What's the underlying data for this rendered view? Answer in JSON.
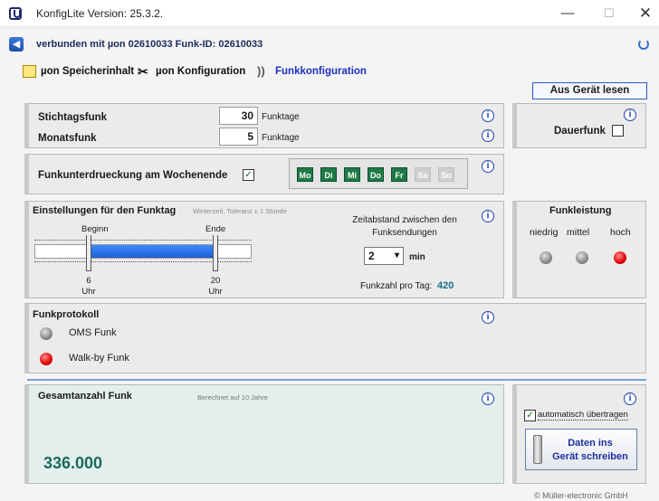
{
  "window": {
    "title": "KonfigLite  Version: 25.3.2."
  },
  "status": {
    "connection": "verbunden mit µon 02610033 Funk-ID: 02610033"
  },
  "tabs": [
    {
      "label": "µon Speicherinhalt"
    },
    {
      "label": "µon Konfiguration"
    },
    {
      "label": "Funkkonfiguration"
    }
  ],
  "read_button": "Aus Gerät lesen",
  "stichtag": {
    "label": "Stichtagsfunk",
    "value": "30",
    "unit": "Funktage"
  },
  "monat": {
    "label": "Monatsfunk",
    "value": "5",
    "unit": "Funktage"
  },
  "dauerfunk": {
    "label": "Dauerfunk"
  },
  "weekend": {
    "label": "Funkunterdrueckung am Wochenende",
    "checked_glyph": "✓",
    "days": [
      "Mo",
      "Di",
      "Mi",
      "Do",
      "Fr",
      "Sa",
      "So"
    ]
  },
  "funktag": {
    "title": "Einstellungen für den Funktag",
    "note": "Winterzeit, Toleranz ± 1 Stunde",
    "begin_label": "Beginn",
    "end_label": "Ende",
    "begin_value": "6",
    "end_value": "20",
    "unit": "Uhr",
    "range_start": 6,
    "range_end": 20,
    "interval_title": "Zeitabstand zwischen den Funksendungen",
    "interval_value": "2",
    "interval_unit": "min",
    "count_label": "Funkzahl pro Tag:",
    "count_value": "420"
  },
  "funkleistung": {
    "title": "Funkleistung",
    "levels": [
      "niedrig",
      "mittel",
      "hoch"
    ],
    "selected": "hoch"
  },
  "protokoll": {
    "title": "Funkprotokoll",
    "items": [
      {
        "label": "OMS Funk",
        "state": "off"
      },
      {
        "label": "Walk-by Funk",
        "state": "on"
      }
    ]
  },
  "gesamt": {
    "title": "Gesamtanzahl Funk",
    "note": "Berechnet auf 10 Jahre",
    "value": "336.000"
  },
  "auto": {
    "label": "automatisch übertragen",
    "checked_glyph": "✓"
  },
  "write_button": {
    "line1": "Daten ins",
    "line2": "Gerät schreiben"
  },
  "footer": "© Müller-electronic GmbH"
}
